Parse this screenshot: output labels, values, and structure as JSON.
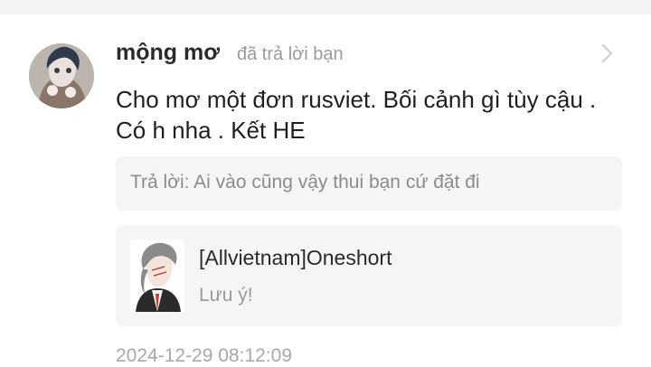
{
  "comment": {
    "avatar_icon": "user-avatar-image",
    "username": "mộng mơ",
    "action_text": "đã trả lời bạn",
    "chevron_icon": "chevron-right-icon",
    "message": "Cho mơ một đơn rusviet.  Bối cảnh gì tùy cậu . Có h nha . Kết HE",
    "quoted_reply": "Trả lời: Ai vào cũng vậy thui bạn cứ đặt đi",
    "story": {
      "cover_icon": "story-cover-image",
      "title": "[Allvietnam]Oneshort",
      "subtitle": "Lưu ý!"
    },
    "timestamp": "2024-12-29 08:12:09"
  },
  "colors": {
    "username": "#2b2b2b",
    "meta": "#9a9a9a",
    "card_background": "#f5f5f5",
    "top_strip": "#f3f3f3"
  }
}
